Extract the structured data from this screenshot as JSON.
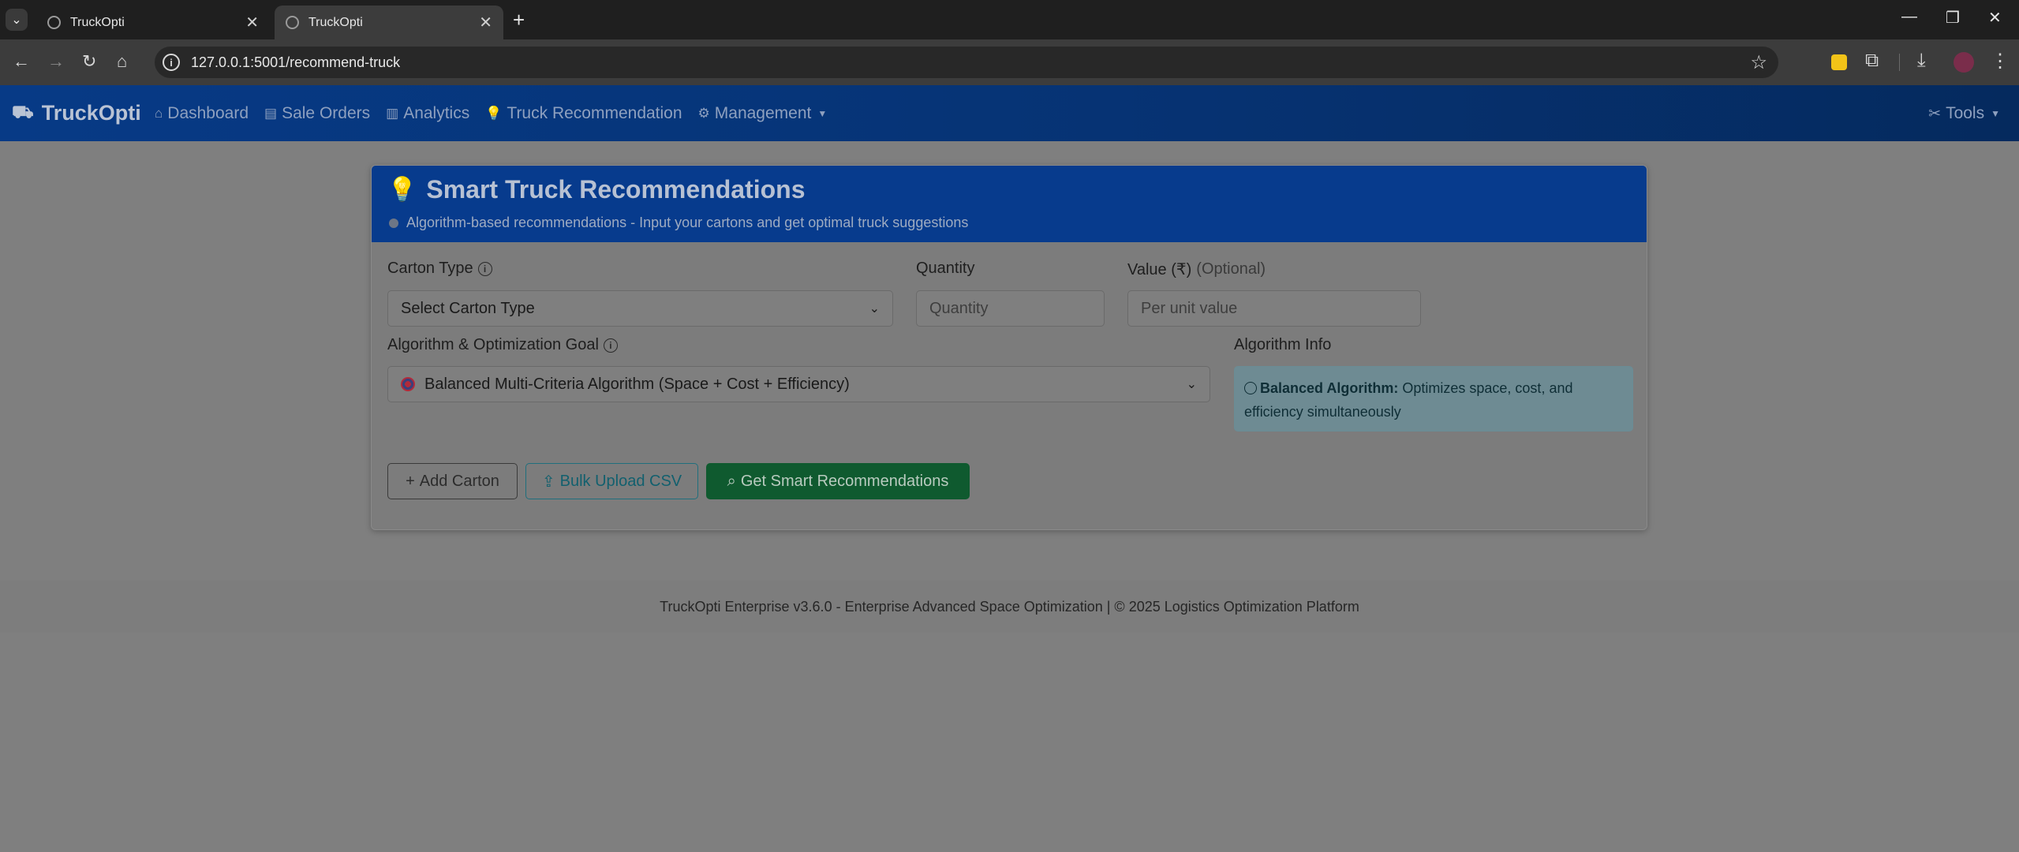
{
  "browser": {
    "tabs": [
      {
        "title": "TruckOpti"
      },
      {
        "title": "TruckOpti"
      }
    ],
    "url": "127.0.0.1:5001/recommend-truck"
  },
  "navbar": {
    "brand": "TruckOpti",
    "links": [
      {
        "label": "Dashboard",
        "icon": "home-icon"
      },
      {
        "label": "Sale Orders",
        "icon": "document-icon"
      },
      {
        "label": "Analytics",
        "icon": "bar-chart-icon"
      },
      {
        "label": "Truck Recommendation",
        "icon": "lightbulb-icon"
      },
      {
        "label": "Management",
        "icon": "gear-icon"
      }
    ],
    "tools_label": "Tools"
  },
  "card": {
    "title": "Smart Truck Recommendations",
    "subtitle": "Algorithm-based recommendations - Input your cartons and get optimal truck suggestions"
  },
  "form": {
    "carton_type_label": "Carton Type",
    "carton_type_value": "Select Carton Type",
    "quantity_label": "Quantity",
    "quantity_placeholder": "Quantity",
    "value_label": "Value (₹)",
    "value_optional": "(Optional)",
    "value_placeholder": "Per unit value",
    "algorithm_label": "Algorithm & Optimization Goal",
    "algorithm_value": "Balanced Multi-Criteria Algorithm (Space + Cost + Efficiency)",
    "algorithm_info_label": "Algorithm Info",
    "algorithm_info_title": "Balanced Algorithm:",
    "algorithm_info_text": "Optimizes space, cost, and efficiency simultaneously"
  },
  "buttons": {
    "add_carton": "Add Carton",
    "bulk_upload": "Bulk Upload CSV",
    "get_recommendations": "Get Smart Recommendations"
  },
  "footer": {
    "text": "TruckOpti Enterprise v3.6.0 - Enterprise Advanced Space Optimization | © 2025 Logistics Optimization Platform"
  },
  "colors": {
    "navbar": "#073a86",
    "card_header": "#073b8d",
    "success_button": "#0f5a2f",
    "overlay_background": "#7f7f7f"
  }
}
